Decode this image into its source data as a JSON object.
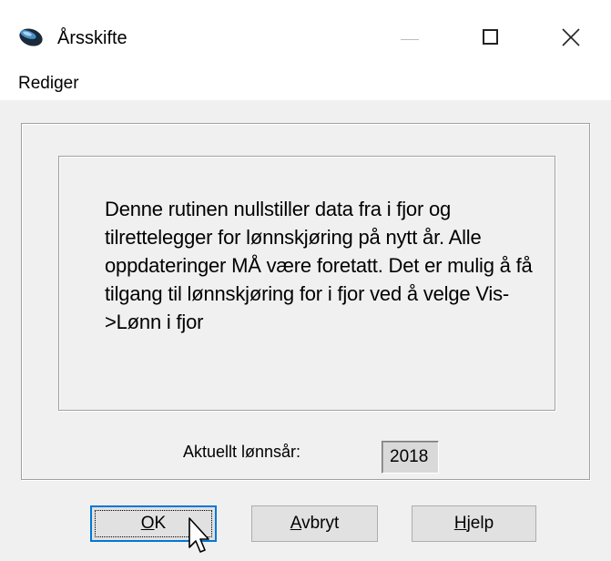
{
  "window": {
    "title": "Årsskifte",
    "icon": "app-logo-icon",
    "controls": [
      "minimize-icon",
      "maximize-icon",
      "close-icon"
    ]
  },
  "menu": {
    "items": [
      {
        "label": "Rediger"
      }
    ]
  },
  "message": "Denne rutinen nullstiller data fra i fjor og tilrettelegger for lønnskjøring på nytt år. Alle oppdateringer MÅ være foretatt. Det er mulig å få tilgang til lønnskjøring for i fjor ved å velge Vis->Lønn i fjor",
  "year_field": {
    "label": "Aktuellt lønnsår:",
    "value": "2018"
  },
  "buttons": {
    "ok": {
      "mnemonic": "O",
      "rest": "K"
    },
    "cancel": {
      "mnemonic": "A",
      "rest": "vbryt"
    },
    "help": {
      "mnemonic": "H",
      "rest": "jelp"
    }
  },
  "colors": {
    "dialog_bg": "#f0f0f0",
    "focus_border": "#0078d7",
    "button_bg": "#e1e1e1",
    "field_bg": "#d9d9d9"
  }
}
